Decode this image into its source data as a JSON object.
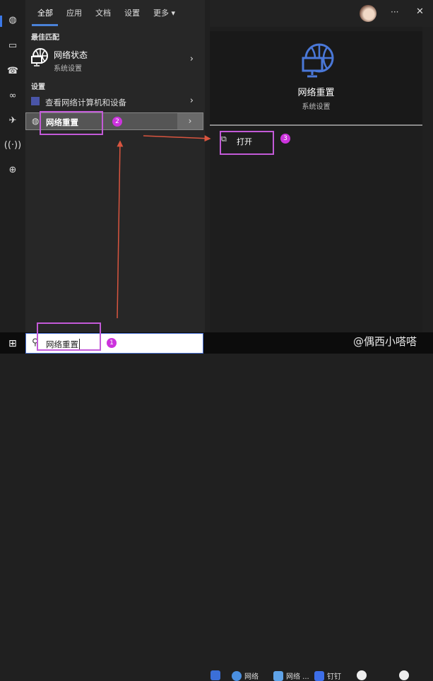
{
  "tabs": [
    "全部",
    "应用",
    "文档",
    "设置",
    "更多"
  ],
  "best_match": {
    "heading": "最佳匹配",
    "title": "网络状态",
    "subtitle": "系统设置"
  },
  "settings": {
    "heading": "设置",
    "items": [
      {
        "label": "查看网络计算机和设备"
      },
      {
        "label": "网络重置"
      }
    ]
  },
  "detail": {
    "title": "网络重置",
    "subtitle": "系统设置",
    "action": "打开"
  },
  "header": {
    "more": "···",
    "close": "✕"
  },
  "search": {
    "value": "网络重置"
  },
  "taskbar": {
    "items": [
      "网络",
      "网络 ...",
      "钉钉"
    ]
  },
  "annotations": [
    "1",
    "2",
    "3"
  ],
  "watermark": "@偶西小嗒嗒",
  "colors": {
    "accent": "#3b78e7",
    "annotation": "#c35ad8",
    "arrow": "#d9553f"
  }
}
